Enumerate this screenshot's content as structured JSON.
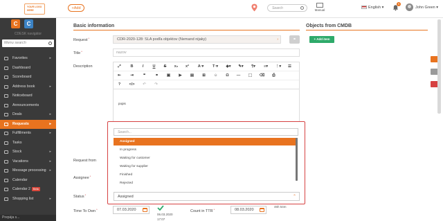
{
  "header": {
    "logo_text": "YOUR LOGO HERE",
    "add_label": "+Add",
    "search_placeholder": "Search",
    "manual_label": "Manual",
    "language": "English",
    "notifications_count": "9",
    "user_name": "John Green"
  },
  "sidebar": {
    "company_name": "CDESK navigátor",
    "search_placeholder": "Menu search",
    "items": [
      {
        "label": "Favorites",
        "arrow": "▸"
      },
      {
        "label": "Dashboard",
        "arrow": ""
      },
      {
        "label": "Scoreboard",
        "arrow": ""
      },
      {
        "label": "Address book",
        "arrow": "▸"
      },
      {
        "label": "Noticeboard",
        "arrow": ""
      },
      {
        "label": "Announcements",
        "arrow": ""
      },
      {
        "label": "Deals",
        "arrow": "▸"
      },
      {
        "label": "Requests",
        "arrow": "▸"
      },
      {
        "label": "Fulfillments",
        "arrow": "▸"
      },
      {
        "label": "Tasks",
        "arrow": ""
      },
      {
        "label": "Stock",
        "arrow": "▸"
      },
      {
        "label": "Vacations",
        "arrow": "▸"
      },
      {
        "label": "Message processing",
        "arrow": "▸"
      },
      {
        "label": "Calendar",
        "arrow": ""
      },
      {
        "label": "Calendar 2",
        "arrow": "",
        "badge": "Beta"
      },
      {
        "label": "Shopping list",
        "arrow": "▸"
      }
    ],
    "footer": "Prepája s..."
  },
  "form": {
    "basic_info_title": "Basic information",
    "request_label": "Request",
    "request_value": "CDR-2020-128: SLA podľa objektov (Nemand nijaky)",
    "title_label": "Title",
    "title_placeholder": "nazov",
    "description_label": "Description",
    "description_text": "popis",
    "request_from_label": "Request from",
    "assignee_label": "Assignee",
    "status_label": "Status",
    "time_to_own_label": "Time To Own",
    "time_to_own_value": "07.03.2020",
    "due_date_value": "06.03.2020",
    "due_time_value": "17:07",
    "count_in_ttr_label": "Count in TTR",
    "count_in_ttr_value": "08.03.2020",
    "duration_value": "46h 54m"
  },
  "cmdb": {
    "title": "Objects from CMDB",
    "add_item_label": "+ Add item"
  },
  "status_dropdown": {
    "search_placeholder": "Search...",
    "options": [
      "Assigned",
      "In progress",
      "Waiting for customer",
      "Waiting for supplier",
      "Finished",
      "Rejected"
    ],
    "selected": "Assigned"
  },
  "colors": {
    "accent": "#e8731f",
    "highlight_border": "#d64141",
    "add_item_green": "#2eaa6a",
    "sidebar_bg": "#3a3a3a"
  }
}
